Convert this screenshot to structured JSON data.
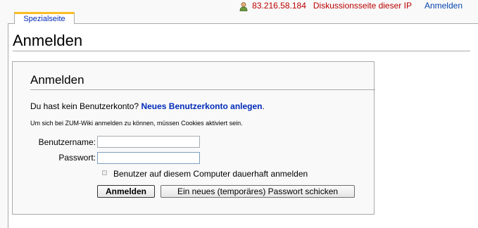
{
  "personal": {
    "ip": "83.216.58.184",
    "talk": "Diskussionsseite dieser IP",
    "login": "Anmelden",
    "icon": "user-icon"
  },
  "tab": {
    "label": "Spezialseite"
  },
  "page": {
    "title": "Anmelden"
  },
  "login_box": {
    "title": "Anmelden",
    "no_account_text": "Du hast kein Benutzerkonto?",
    "create_account_link": "Neues Benutzerkonto anlegen",
    "period": ".",
    "cookie_note": "Um sich bei ZUM-Wiki anmelden zu können, müssen Cookies aktiviert sein.",
    "username_label": "Benutzername:",
    "username_value": "",
    "password_label": "Passwort:",
    "password_value": "",
    "remember_label": "Benutzer auf diesem Computer dauerhaft anmelden",
    "remember_checked": false,
    "login_button": "Anmelden",
    "reset_button": "Ein neues (temporäres) Passwort schicken"
  },
  "colors": {
    "tab_accent": "#fabd23",
    "link_blue": "#0645ad",
    "link_red": "#ba0000"
  }
}
